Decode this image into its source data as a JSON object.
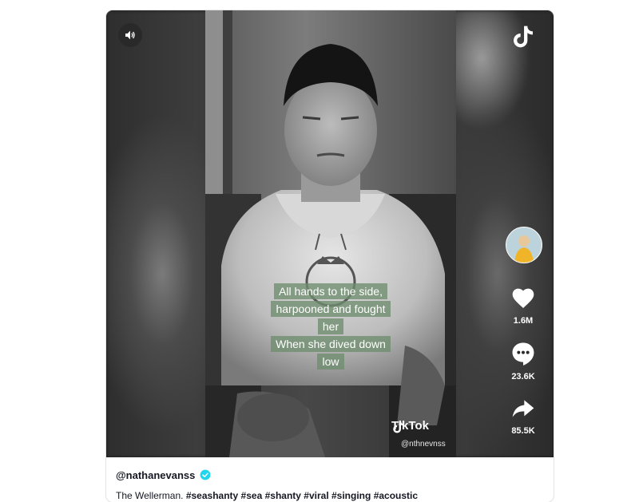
{
  "video": {
    "caption_lines": [
      "All hands to the side,",
      "harpooned and fought",
      "her",
      "When she dived down",
      "low"
    ],
    "watermark_logo": "TikTok",
    "watermark_handle": "@nthnevnss"
  },
  "icons": {
    "volume": "volume-icon",
    "tiktok": "tiktok-logo-icon",
    "like": "heart-icon",
    "comment": "comment-icon",
    "share": "share-icon",
    "verified": "verified-badge-icon"
  },
  "actions": {
    "likes": "1.6M",
    "comments": "23.6K",
    "shares": "85.5K"
  },
  "author": {
    "username": "@nathanevanss"
  },
  "description": {
    "text": "The Wellerman.",
    "hashtags": [
      "#seashanty",
      "#sea",
      "#shanty",
      "#viral",
      "#singing",
      "#acoustic"
    ]
  },
  "colors": {
    "verified": "#20d5ec",
    "caption_bg": "#6e8c6e",
    "text_dark": "#161823"
  }
}
